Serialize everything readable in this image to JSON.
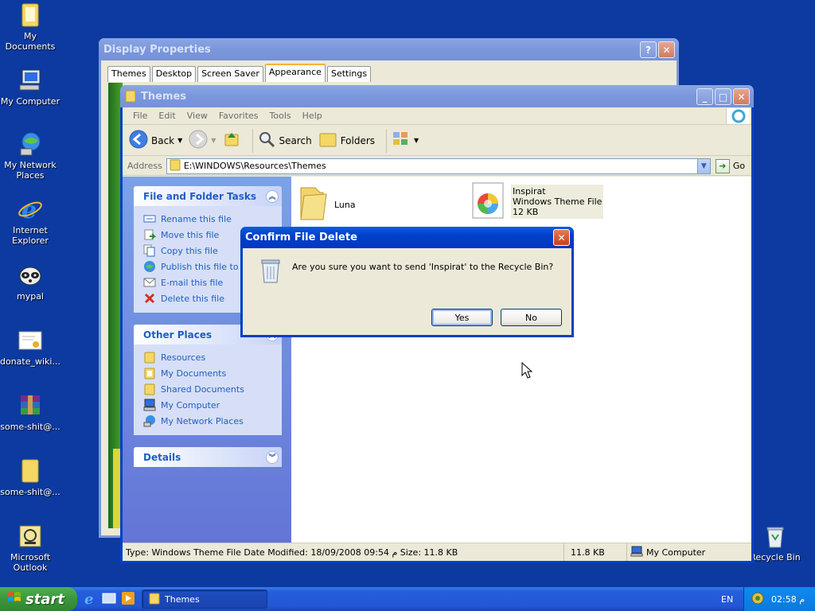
{
  "desktop": {
    "icons": [
      {
        "label": "My Documents",
        "icon": "folder-documents-icon"
      },
      {
        "label": "My Computer",
        "icon": "computer-icon"
      },
      {
        "label": "My Network\nPlaces",
        "icon": "network-icon"
      },
      {
        "label": "Internet\nExplorer",
        "icon": "ie-icon"
      },
      {
        "label": "mypal",
        "icon": "raccoon-icon"
      },
      {
        "label": "donate_wiki...",
        "icon": "certificate-icon"
      },
      {
        "label": "some-shit@...",
        "icon": "winrar-icon"
      },
      {
        "label": "some-shit@...",
        "icon": "folder-icon"
      },
      {
        "label": "Microsoft\nOutlook",
        "icon": "outlook-icon"
      },
      {
        "label": "Recycle Bin",
        "icon": "recycle-bin-icon"
      }
    ]
  },
  "display_props": {
    "title": "Display Properties",
    "tabs": [
      "Themes",
      "Desktop",
      "Screen Saver",
      "Appearance",
      "Settings"
    ],
    "active_tab": "Appearance"
  },
  "themes_window": {
    "title": "Themes",
    "menu": [
      "File",
      "Edit",
      "View",
      "Favorites",
      "Tools",
      "Help"
    ],
    "toolbar": {
      "back": "Back",
      "search": "Search",
      "folders": "Folders"
    },
    "address_label": "Address",
    "address_value": "E:\\WINDOWS\\Resources\\Themes",
    "go_label": "Go",
    "tasks": {
      "title": "File and Folder Tasks",
      "items": [
        "Rename this file",
        "Move this file",
        "Copy this file",
        "Publish this file to the Web",
        "E-mail this file",
        "Delete this file"
      ]
    },
    "other_places": {
      "title": "Other Places",
      "items": [
        "Resources",
        "My Documents",
        "Shared Documents",
        "My Computer",
        "My Network Places"
      ]
    },
    "details": {
      "title": "Details"
    },
    "files": [
      {
        "name": "Luna"
      },
      {
        "name": "Inspirat",
        "type": "Windows Theme File",
        "size": "12 KB"
      }
    ],
    "status": {
      "info": "Type: Windows Theme File Date Modified: 18/09/2008 09:54 م Size: 11.8 KB",
      "size": "11.8 KB",
      "location": "My Computer"
    }
  },
  "dialog": {
    "title": "Confirm File Delete",
    "message": "Are you sure you want to send 'Inspirat' to the Recycle Bin?",
    "yes": "Yes",
    "no": "No"
  },
  "taskbar": {
    "start": "start",
    "task": "Themes",
    "lang": "EN",
    "clock": "02:58 م"
  }
}
